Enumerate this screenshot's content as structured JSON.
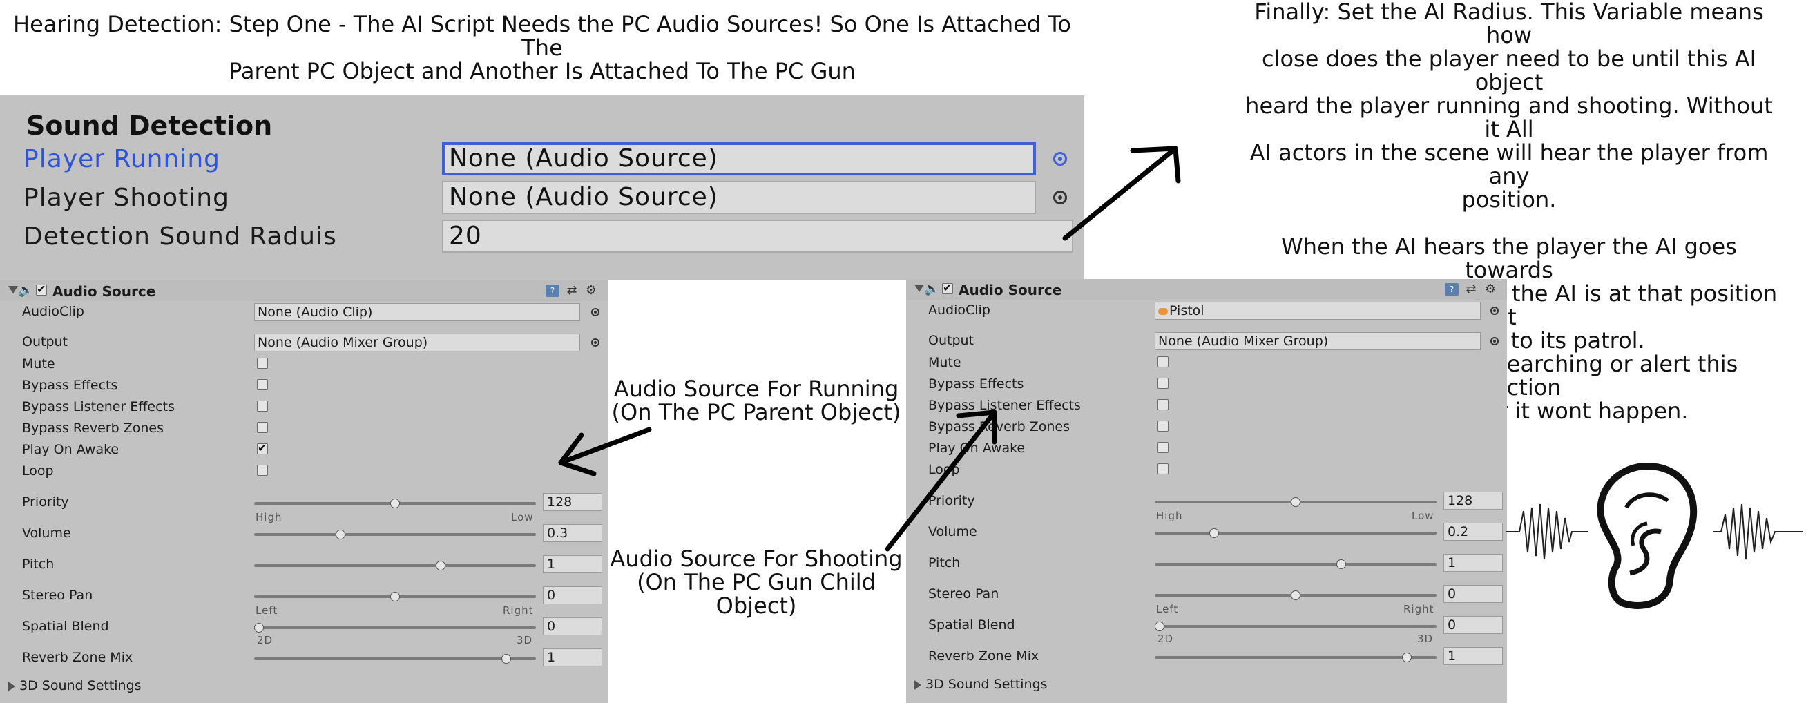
{
  "captions": {
    "top_left": [
      "Hearing Detection: Step One - The AI Script Needs the PC Audio Sources! So One Is Attached To The",
      "Parent PC Object and Another Is Attached To The PC Gun"
    ],
    "top_right": [
      "Finally: Set the AI Radius. This Variable means how",
      "close does the player need to be until this AI object",
      "heard the player running and shooting. Without it All",
      "AI actors in the scene will hear the player from any",
      "position.",
      "",
      "When the AI hears the player the AI goes towards",
      "the noise position. After the AI is at that position it",
      "will go back to its patrol.",
      "When the player is searching or alert this detection",
      "does not matter it wont happen."
    ],
    "running": [
      "Audio Source For Running",
      "(On The PC Parent Object)"
    ],
    "shooting": [
      "Audio Source For Shooting",
      "(On The PC Gun Child",
      "Object)"
    ]
  },
  "sound_detection": {
    "title": "Sound Detection",
    "fields": [
      {
        "label": "Player Running",
        "value": "None (Audio Source)"
      },
      {
        "label": "Player Shooting",
        "value": "None (Audio Source)"
      },
      {
        "label": "Detection Sound Raduis",
        "value": "20"
      }
    ]
  },
  "inspectors": [
    {
      "title": "Audio Source",
      "enabled": true,
      "audio_clip": {
        "label": "AudioClip",
        "value": "None (Audio Clip)"
      },
      "output": {
        "label": "Output",
        "value": "None (Audio Mixer Group)"
      },
      "toggles": [
        {
          "label": "Mute",
          "checked": false
        },
        {
          "label": "Bypass Effects",
          "checked": false
        },
        {
          "label": "Bypass Listener Effects",
          "checked": false
        },
        {
          "label": "Bypass Reverb Zones",
          "checked": false
        },
        {
          "label": "Play On Awake",
          "checked": true
        },
        {
          "label": "Loop",
          "checked": false
        }
      ],
      "sliders": [
        {
          "label": "Priority",
          "value": "128",
          "fraction": 0.5,
          "left": "High",
          "right": "Low"
        },
        {
          "label": "Volume",
          "value": "0.3",
          "fraction": 0.3
        },
        {
          "label": "Pitch",
          "value": "1",
          "fraction": 0.667
        },
        {
          "label": "Stereo Pan",
          "value": "0",
          "fraction": 0.5,
          "left": "Left",
          "right": "Right"
        },
        {
          "label": "Spatial Blend",
          "value": "0",
          "fraction": 0.0,
          "left": "2D",
          "right": "3D"
        },
        {
          "label": "Reverb Zone Mix",
          "value": "1",
          "fraction": 0.909
        }
      ],
      "foldout": "3D Sound Settings"
    },
    {
      "title": "Audio Source",
      "enabled": true,
      "audio_clip": {
        "label": "AudioClip",
        "value": "Pistol"
      },
      "output": {
        "label": "Output",
        "value": "None (Audio Mixer Group)"
      },
      "toggles": [
        {
          "label": "Mute",
          "checked": false
        },
        {
          "label": "Bypass Effects",
          "checked": false
        },
        {
          "label": "Bypass Listener Effects",
          "checked": false
        },
        {
          "label": "Bypass Reverb Zones",
          "checked": false
        },
        {
          "label": "Play On Awake",
          "checked": false
        },
        {
          "label": "Loop",
          "checked": false
        }
      ],
      "sliders": [
        {
          "label": "Priority",
          "value": "128",
          "fraction": 0.5,
          "left": "High",
          "right": "Low"
        },
        {
          "label": "Volume",
          "value": "0.2",
          "fraction": 0.2
        },
        {
          "label": "Pitch",
          "value": "1",
          "fraction": 0.667
        },
        {
          "label": "Stereo Pan",
          "value": "0",
          "fraction": 0.5,
          "left": "Left",
          "right": "Right"
        },
        {
          "label": "Spatial Blend",
          "value": "0",
          "fraction": 0.0,
          "left": "2D",
          "right": "3D"
        },
        {
          "label": "Reverb Zone Mix",
          "value": "1",
          "fraction": 0.909
        }
      ],
      "foldout": "3D Sound Settings"
    }
  ],
  "colors": {
    "active_label": "#2e55d8",
    "focus_border": "#3f5fd6",
    "panel_bg": "#c2c2c2"
  },
  "icons": [
    "speaker-icon",
    "help-book-icon",
    "preset-icon",
    "gear-icon",
    "object-picker-icon",
    "ear-icon",
    "arrow-icon"
  ]
}
